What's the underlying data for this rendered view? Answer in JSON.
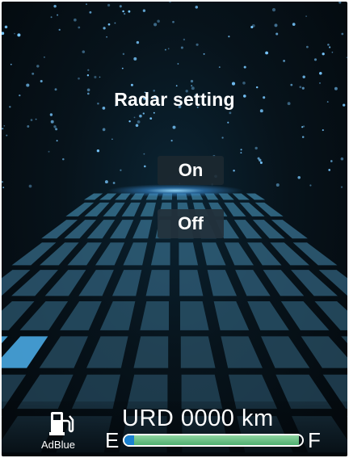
{
  "screen": {
    "title": "Radar setting",
    "options": [
      {
        "label": "On",
        "selected": true
      },
      {
        "label": "Off",
        "selected": false
      }
    ]
  },
  "status": {
    "fuel_icon": "fuel-pump-icon",
    "adblue_label": "AdBlue",
    "urd_text": "URD 0000 km",
    "gauge_empty": "E",
    "gauge_full": "F",
    "gauge_level": 0.98
  },
  "colors": {
    "accent_glow": "#6ec8ff",
    "tile_blue": "#3f93c9",
    "gauge_green": "#6cc487"
  }
}
